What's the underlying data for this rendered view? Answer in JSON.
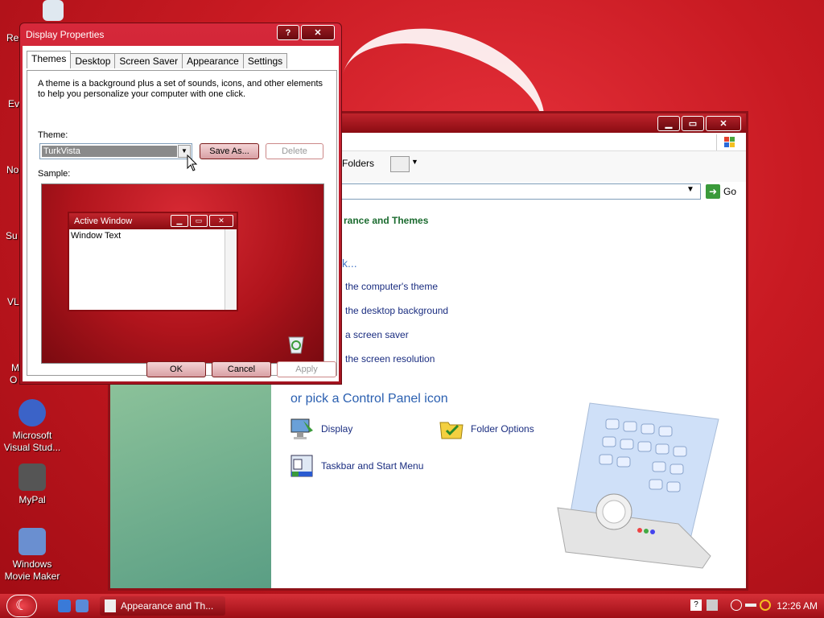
{
  "desktop": {
    "clipped_labels": [
      "Re",
      "Ev",
      "No",
      "Su",
      "VL",
      "M",
      "O"
    ],
    "icons": [
      {
        "label": "Microsoft Visual Stud...",
        "color": "#3b63c8"
      },
      {
        "label": "MyPal",
        "color": "#444444"
      },
      {
        "label": "Windows Movie Maker",
        "color": "#6a8fd0"
      }
    ]
  },
  "control_panel": {
    "title_buttons": [
      "▁",
      "▭",
      "✕"
    ],
    "toolbar": {
      "folders_label": "Folders"
    },
    "address": {
      "go_label": "Go"
    },
    "crumb": "rance and Themes",
    "pick_task": "k...",
    "tasks": [
      "the computer's theme",
      "the desktop background",
      "a screen saver",
      "the screen resolution"
    ],
    "or_pick": "or pick a Control Panel icon",
    "icons": [
      {
        "label": "Display",
        "icon": "display-icon"
      },
      {
        "label": "Folder Options",
        "icon": "folder-options-icon"
      },
      {
        "label": "Taskbar and Start Menu",
        "icon": "taskbar-start-menu-icon"
      }
    ]
  },
  "dialog": {
    "title": "Display Properties",
    "title_buttons": [
      "?",
      "✕"
    ],
    "tabs": [
      "Themes",
      "Desktop",
      "Screen Saver",
      "Appearance",
      "Settings"
    ],
    "description": "A theme is a background plus a set of sounds, icons, and other elements to help you personalize your computer with one click.",
    "theme_label": "Theme:",
    "theme_value": "TurkVista",
    "save_as": "Save As...",
    "delete": "Delete",
    "sample_label": "Sample:",
    "sample": {
      "active_window_title": "Active Window",
      "window_text": "Window Text",
      "buttons": [
        "▁",
        "▭",
        "✕"
      ]
    },
    "ok": "OK",
    "cancel": "Cancel",
    "apply": "Apply"
  },
  "taskbar": {
    "task_label": "Appearance and Th...",
    "clock": "12:26 AM",
    "accent": "#c81a22"
  }
}
